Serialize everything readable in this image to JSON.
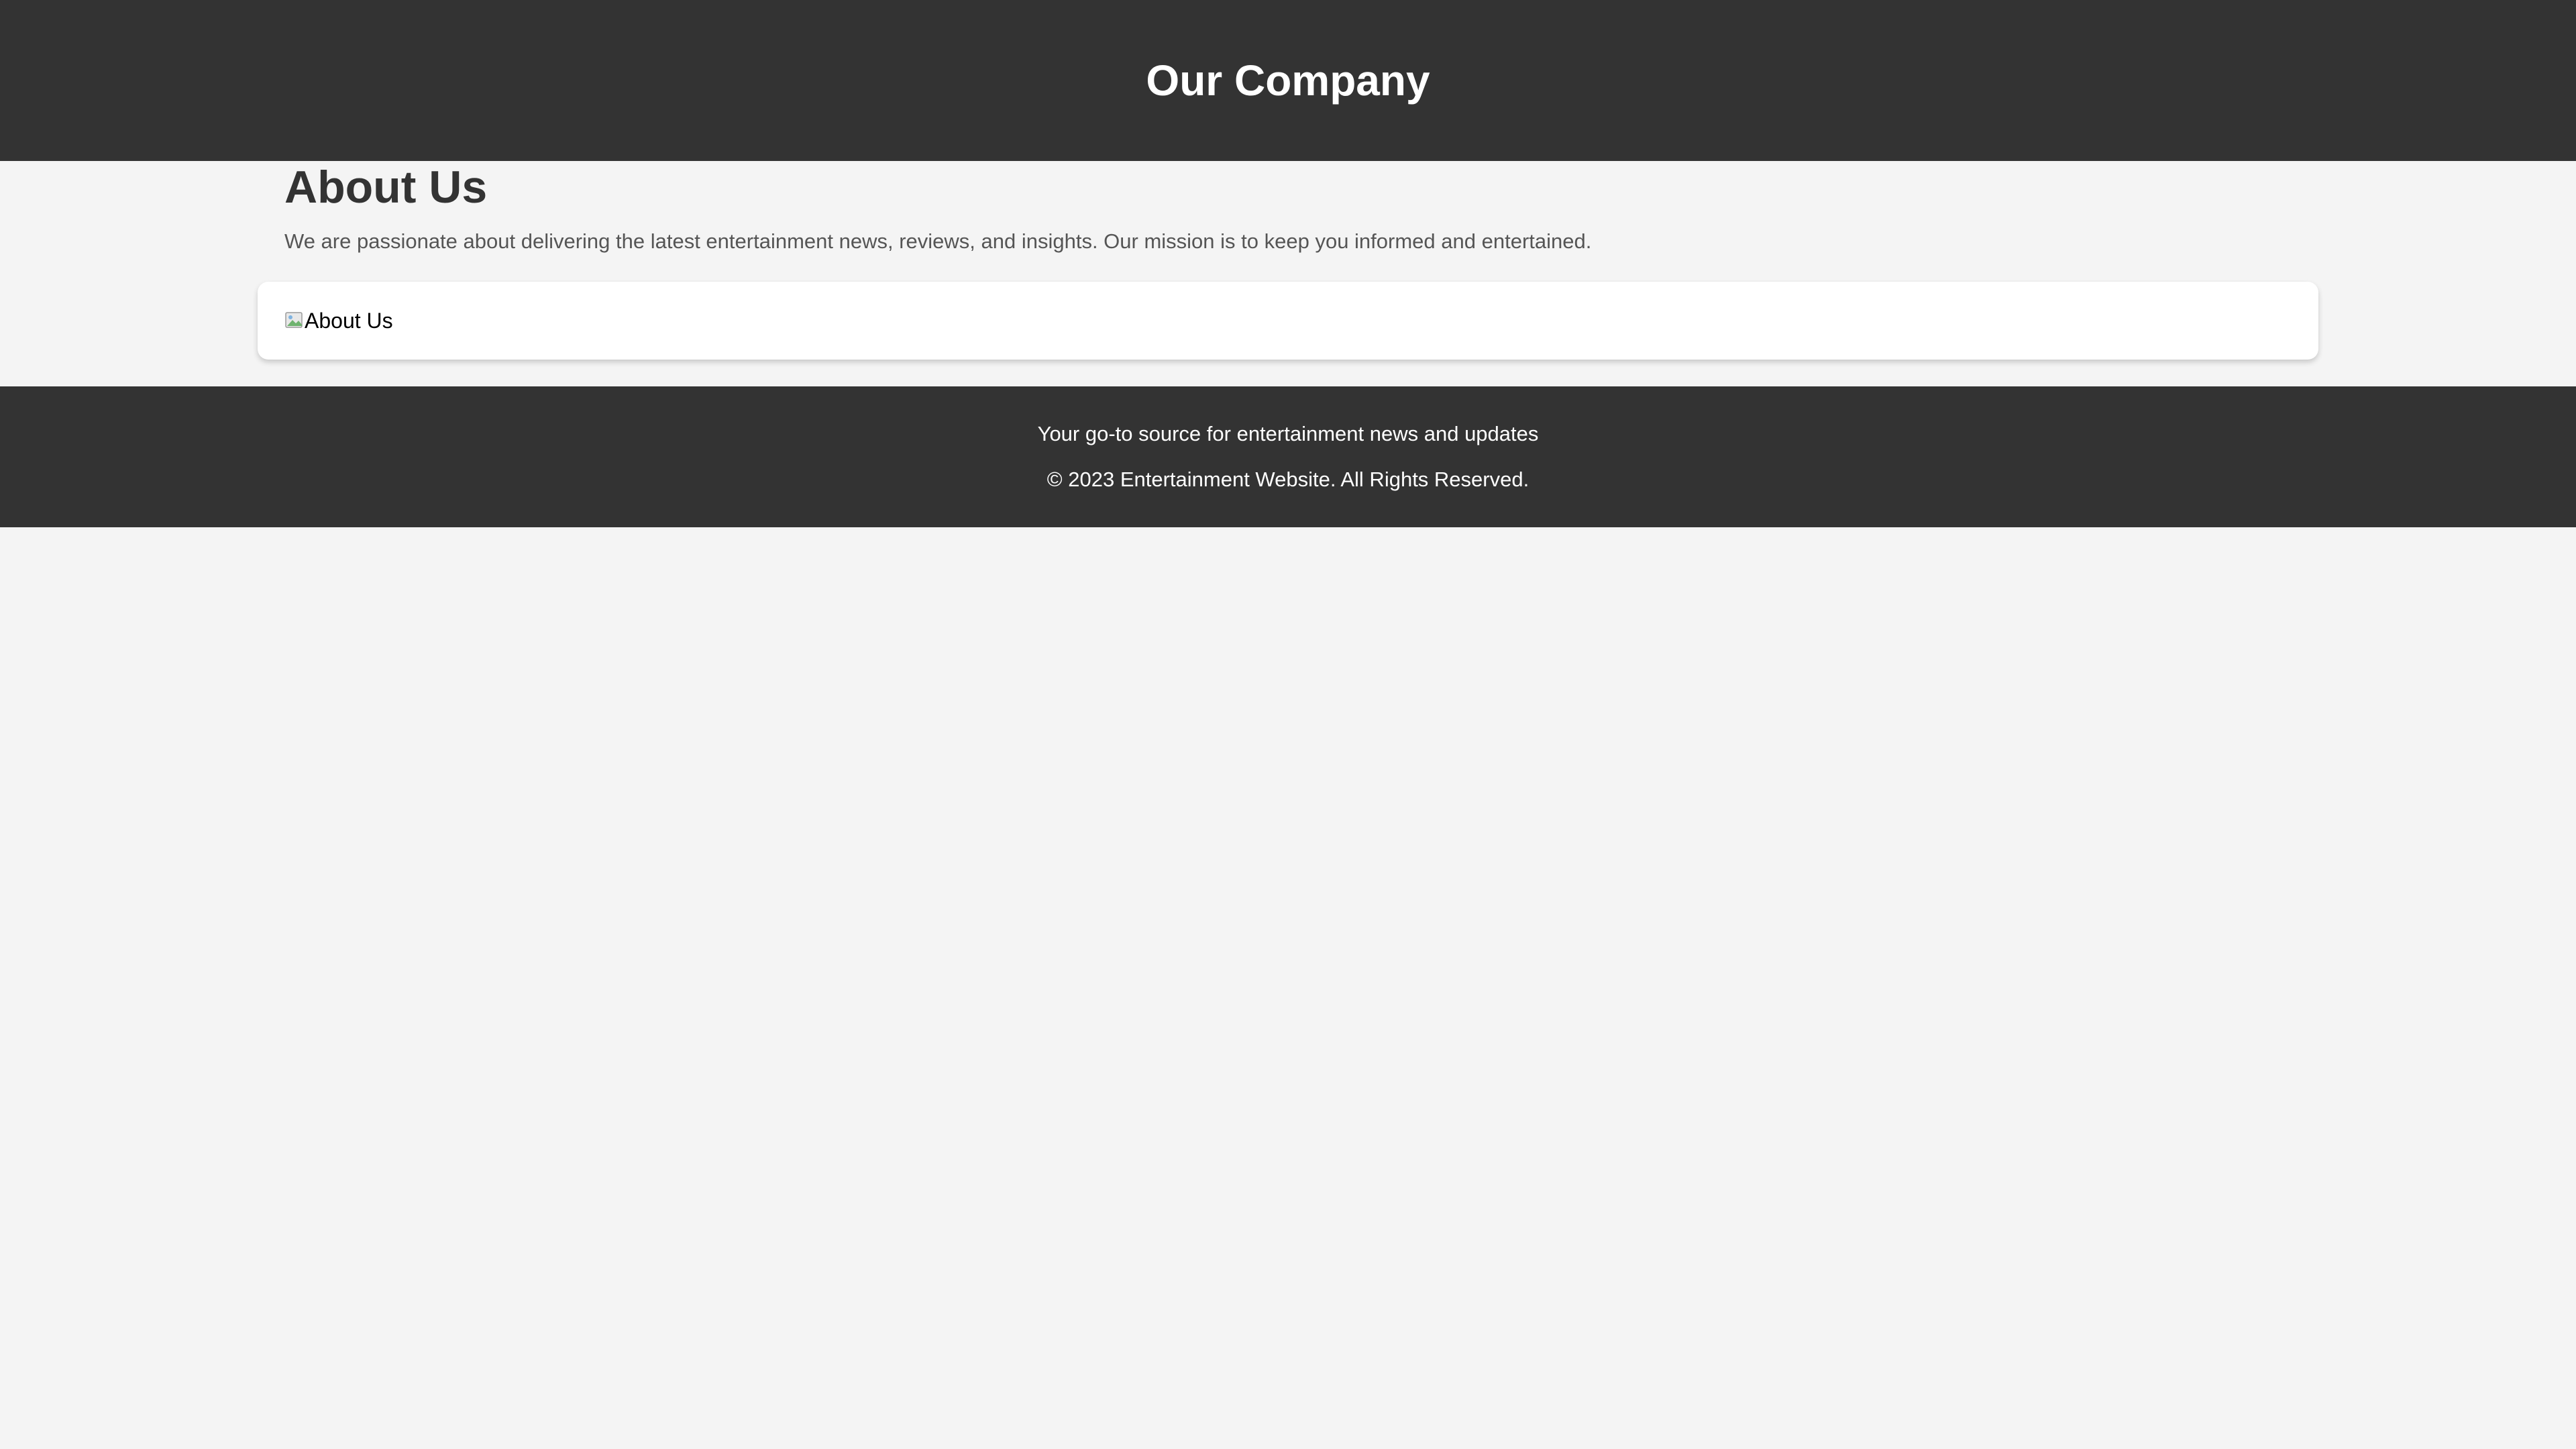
{
  "header": {
    "title": "Our Company"
  },
  "about": {
    "heading": "About Us",
    "description": "We are passionate about delivering the latest entertainment news, reviews, and insights. Our mission is to keep you informed and entertained.",
    "image_alt": "About Us",
    "image_icon": "broken-image-icon"
  },
  "footer": {
    "tagline": "Your go-to source for entertainment news and updates",
    "copyright": "© 2023 Entertainment Website. All Rights Reserved."
  },
  "colors": {
    "header_bg": "#333333",
    "page_bg": "#f4f4f4",
    "card_bg": "#ffffff",
    "heading_text": "#333333",
    "body_text": "#555555"
  }
}
